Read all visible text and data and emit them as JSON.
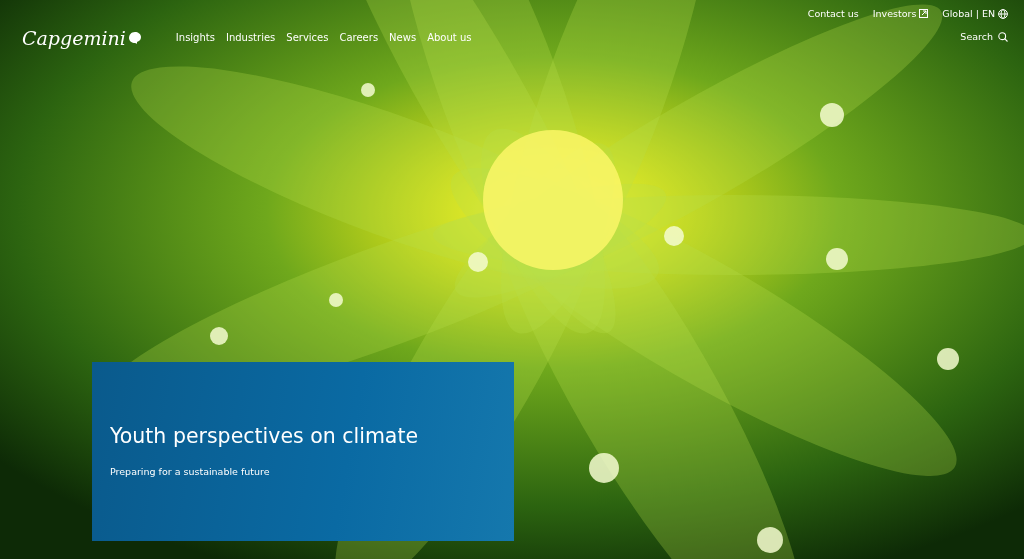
{
  "logo": "Capgemini",
  "nav": [
    "Insights",
    "Industries",
    "Services",
    "Careers",
    "News",
    "About us"
  ],
  "utility_links": [
    {
      "label": "Contact us",
      "kind": "plain"
    },
    {
      "label": "Investors",
      "kind": "external"
    },
    {
      "label": "Global | EN",
      "kind": "globe"
    }
  ],
  "search": {
    "label": "Search"
  },
  "hero": {
    "kind": "picture",
    "title": "Youth perspectives on climate",
    "subtitle": "Preparing for a sustainable future"
  }
}
